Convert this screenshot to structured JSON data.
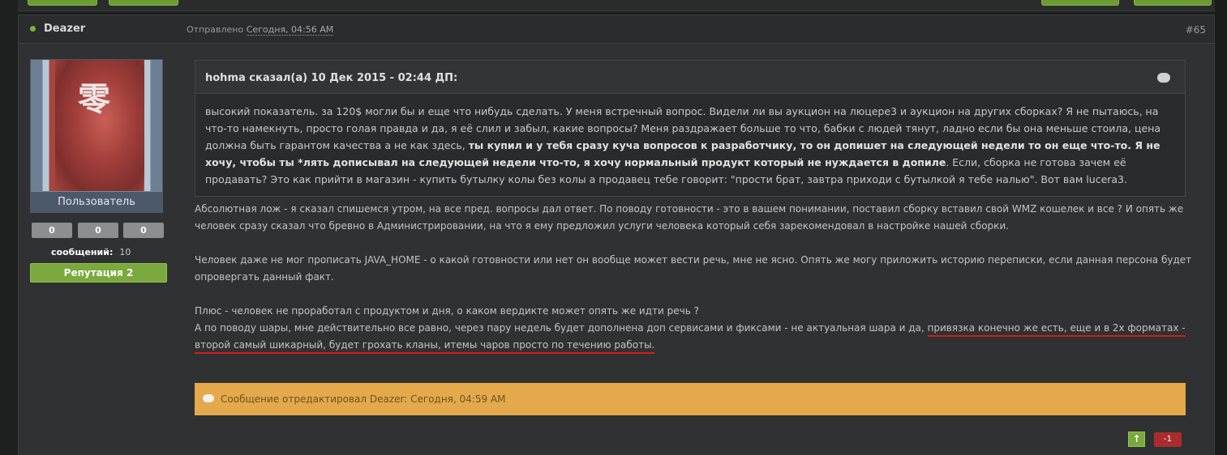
{
  "post": {
    "author": "Deazer",
    "posted_prefix": "Отправлено",
    "posted_time": "Сегодня, 04:56 AM",
    "post_number": "#65"
  },
  "user": {
    "group": "Пользователь",
    "stats": [
      "0",
      "0",
      "0"
    ],
    "messages_label": "сообщений:",
    "messages_value": "10",
    "reputation": "Репутация 2"
  },
  "quote": {
    "header": "hohma сказал(а) 10 Дек 2015 - 02:44 ДП:",
    "text_1": "высокий показатель. за 120$ могли бы и еще что нибудь сделать. У меня встречный вопрос. Видели ли вы аукцион на люцере3 и аукцион на других сборках? Я не пытаюсь, на что-то намекнуть, просто голая правда и да, я её слил и забыл, какие вопросы? Меня раздражает больше то что, бабки с людей тянут, ладно если бы она меньше стоила, цена должна быть гарантом качества а не как здесь, ",
    "text_bold": "ты купил и у тебя сразу куча вопросов к разработчику, то он допишет на следующей недели то он еще что-то. Я не хочу, чтобы ты *лять дописывал на следующей недели что-то, я хочу нормальный продукт который не нуждается в допиле",
    "text_2": ". Если, сборка не готова зачем её продавать? Это как прийти в магазин - купить бутылку колы без колы а продавец тебе говорит: \"прости брат, завтра приходи с бутылкой я тебе налью\". Вот вам lucera3."
  },
  "body": {
    "p1": "Абсолютная лож - я сказал спишемся утром, на все пред. вопросы дал ответ. По поводу готовности - это в вашем понимании, поставил сборку вставил свой WMZ кошелек и все ? И опять же человек сразу сказал что бревно в Администрировании, на что я ему предложил услуги человека который себя зарекомендовал в настройке нашей сборки.",
    "p2": "Человек даже не мог прописать JAVA_HOME - о какой готовности или нет он вообще может вести речь, мне не ясно. Опять же могу приложить историю переписки, если данная персона будет опровергать данный факт.",
    "p3": "Плюс - человек не проработал с продуктом и дня, о каком вердикте может опять же идти речь ?",
    "p4_start": "А по поводу шары, мне действительно все равно, через пару недель будет дополнена доп сервисами и фиксами - не актуальная шара и да, ",
    "p4_underlined": "привязка конечно же есть, еще и в 2х форматах - второй самый шикарный, будет грохать кланы, итемы чаров просто по течению работы."
  },
  "edit_notice": "Сообщение отредактировал Deazer: Сегодня, 04:59 AM",
  "votes": {
    "up_icon": "arrow-up-icon",
    "score": "-1"
  }
}
